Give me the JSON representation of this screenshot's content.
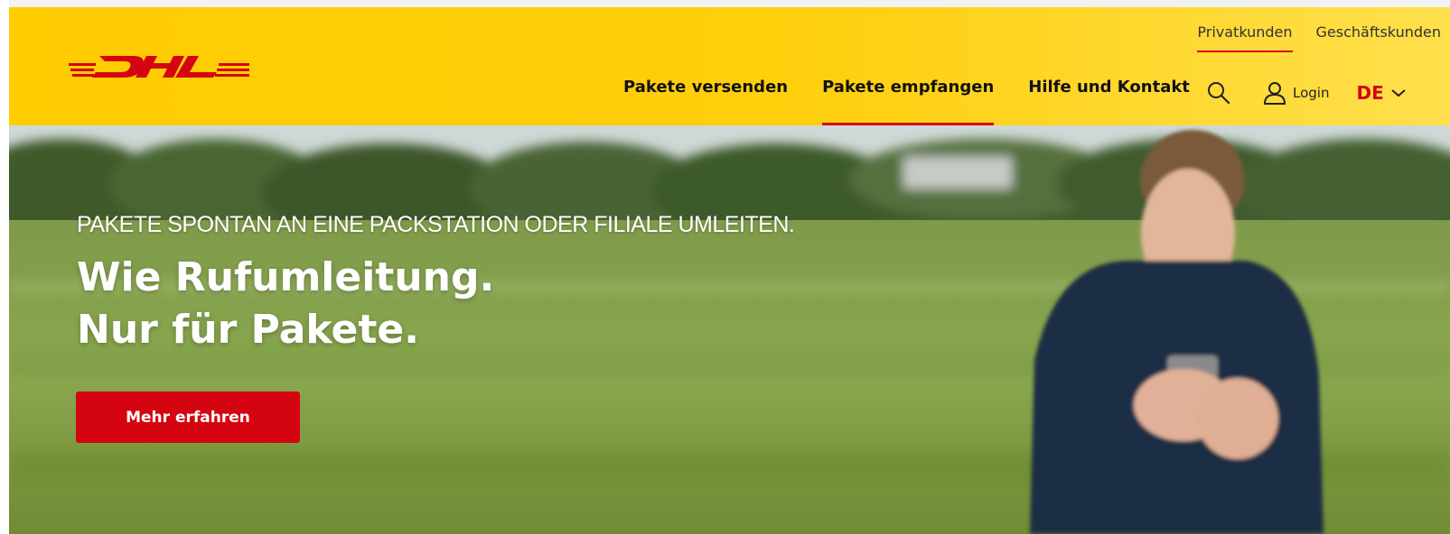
{
  "brand": {
    "logo_text": "DHL",
    "color_yellow": "#ffcc00",
    "color_red": "#d40511"
  },
  "top_links": [
    {
      "label": "Privatkunden",
      "active": true
    },
    {
      "label": "Geschäftskunden",
      "active": false
    }
  ],
  "main_nav": [
    {
      "label": "Pakete versenden",
      "active": false
    },
    {
      "label": "Pakete empfangen",
      "active": true
    },
    {
      "label": "Hilfe und Kontakt",
      "active": false
    }
  ],
  "tools": {
    "search_icon": "search-icon",
    "login_icon": "user-icon",
    "login_label": "Login",
    "language": "DE",
    "language_icon": "chevron-down-icon"
  },
  "hero": {
    "kicker": "PAKETE SPONTAN AN EINE PACKSTATION ODER FILIALE UMLEITEN.",
    "title_line1": "Wie Rufumleitung.",
    "title_line2": "Nur für Pakete.",
    "cta_label": "Mehr erfahren"
  }
}
